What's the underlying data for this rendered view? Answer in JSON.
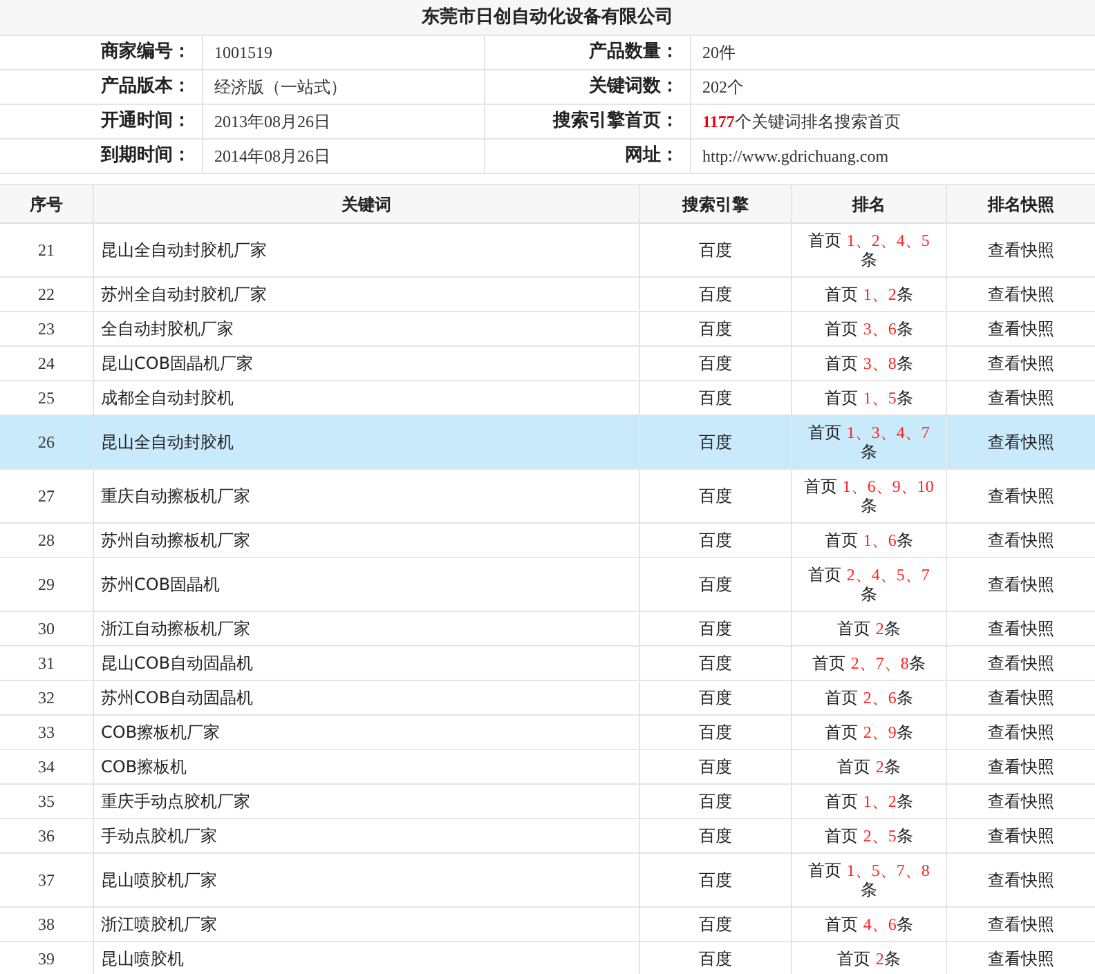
{
  "title": "东莞市日创自动化设备有限公司",
  "info": [
    {
      "left": {
        "label": "商家编号：",
        "value": "1001519"
      },
      "right": {
        "label": "产品数量：",
        "value": "20件"
      }
    },
    {
      "left": {
        "label": "产品版本：",
        "value": "经济版（一站式）"
      },
      "right": {
        "label": "关键词数：",
        "value": "202个"
      }
    },
    {
      "left": {
        "label": "开通时间：",
        "value": "2013年08月26日"
      },
      "right": {
        "label": "搜索引擎首页：",
        "highlight": "1177",
        "value": "个关键词排名搜索首页"
      }
    },
    {
      "left": {
        "label": "到期时间：",
        "value": "2014年08月26日"
      },
      "right": {
        "label": "网址：",
        "value": "http://www.gdrichuang.com"
      }
    }
  ],
  "table": {
    "columns": [
      "序号",
      "关键词",
      "搜索引擎",
      "排名",
      "排名快照"
    ],
    "rows": [
      {
        "no": "21",
        "keyword": "昆山全自动封胶机厂家",
        "engine": "百度",
        "rank_prefix": "首页",
        "rank_positions": "1、2、4、5",
        "rank_suffix": "条",
        "snapshot": "查看快照",
        "selected": false
      },
      {
        "no": "22",
        "keyword": "苏州全自动封胶机厂家",
        "engine": "百度",
        "rank_prefix": "首页",
        "rank_positions": "1、2",
        "rank_suffix": "条",
        "snapshot": "查看快照",
        "selected": false
      },
      {
        "no": "23",
        "keyword": "全自动封胶机厂家",
        "engine": "百度",
        "rank_prefix": "首页",
        "rank_positions": "3、6",
        "rank_suffix": "条",
        "snapshot": "查看快照",
        "selected": false
      },
      {
        "no": "24",
        "keyword": "昆山COB固晶机厂家",
        "engine": "百度",
        "rank_prefix": "首页",
        "rank_positions": "3、8",
        "rank_suffix": "条",
        "snapshot": "查看快照",
        "selected": false
      },
      {
        "no": "25",
        "keyword": "成都全自动封胶机",
        "engine": "百度",
        "rank_prefix": "首页",
        "rank_positions": "1、5",
        "rank_suffix": "条",
        "snapshot": "查看快照",
        "selected": false
      },
      {
        "no": "26",
        "keyword": "昆山全自动封胶机",
        "engine": "百度",
        "rank_prefix": "首页",
        "rank_positions": "1、3、4、7",
        "rank_suffix": "条",
        "snapshot": "查看快照",
        "selected": true
      },
      {
        "no": "27",
        "keyword": "重庆自动擦板机厂家",
        "engine": "百度",
        "rank_prefix": "首页",
        "rank_positions": "1、6、9、10",
        "rank_suffix": "条",
        "snapshot": "查看快照",
        "selected": false
      },
      {
        "no": "28",
        "keyword": "苏州自动擦板机厂家",
        "engine": "百度",
        "rank_prefix": "首页",
        "rank_positions": "1、6",
        "rank_suffix": "条",
        "snapshot": "查看快照",
        "selected": false
      },
      {
        "no": "29",
        "keyword": "苏州COB固晶机",
        "engine": "百度",
        "rank_prefix": "首页",
        "rank_positions": "2、4、5、7",
        "rank_suffix": "条",
        "snapshot": "查看快照",
        "selected": false
      },
      {
        "no": "30",
        "keyword": "浙江自动擦板机厂家",
        "engine": "百度",
        "rank_prefix": "首页",
        "rank_positions": "2",
        "rank_suffix": "条",
        "snapshot": "查看快照",
        "selected": false
      },
      {
        "no": "31",
        "keyword": "昆山COB自动固晶机",
        "engine": "百度",
        "rank_prefix": "首页",
        "rank_positions": "2、7、8",
        "rank_suffix": "条",
        "snapshot": "查看快照",
        "selected": false
      },
      {
        "no": "32",
        "keyword": "苏州COB自动固晶机",
        "engine": "百度",
        "rank_prefix": "首页",
        "rank_positions": "2、6",
        "rank_suffix": "条",
        "snapshot": "查看快照",
        "selected": false
      },
      {
        "no": "33",
        "keyword": "COB擦板机厂家",
        "engine": "百度",
        "rank_prefix": "首页",
        "rank_positions": "2、9",
        "rank_suffix": "条",
        "snapshot": "查看快照",
        "selected": false
      },
      {
        "no": "34",
        "keyword": "COB擦板机",
        "engine": "百度",
        "rank_prefix": "首页",
        "rank_positions": "2",
        "rank_suffix": "条",
        "snapshot": "查看快照",
        "selected": false
      },
      {
        "no": "35",
        "keyword": "重庆手动点胶机厂家",
        "engine": "百度",
        "rank_prefix": "首页",
        "rank_positions": "1、2",
        "rank_suffix": "条",
        "snapshot": "查看快照",
        "selected": false
      },
      {
        "no": "36",
        "keyword": "手动点胶机厂家",
        "engine": "百度",
        "rank_prefix": "首页",
        "rank_positions": "2、5",
        "rank_suffix": "条",
        "snapshot": "查看快照",
        "selected": false
      },
      {
        "no": "37",
        "keyword": "昆山喷胶机厂家",
        "engine": "百度",
        "rank_prefix": "首页",
        "rank_positions": "1、5、7、8",
        "rank_suffix": "条",
        "snapshot": "查看快照",
        "selected": false
      },
      {
        "no": "38",
        "keyword": "浙江喷胶机厂家",
        "engine": "百度",
        "rank_prefix": "首页",
        "rank_positions": "4、6",
        "rank_suffix": "条",
        "snapshot": "查看快照",
        "selected": false
      },
      {
        "no": "39",
        "keyword": "昆山喷胶机",
        "engine": "百度",
        "rank_prefix": "首页",
        "rank_positions": "2",
        "rank_suffix": "条",
        "snapshot": "查看快照",
        "selected": false
      }
    ]
  }
}
